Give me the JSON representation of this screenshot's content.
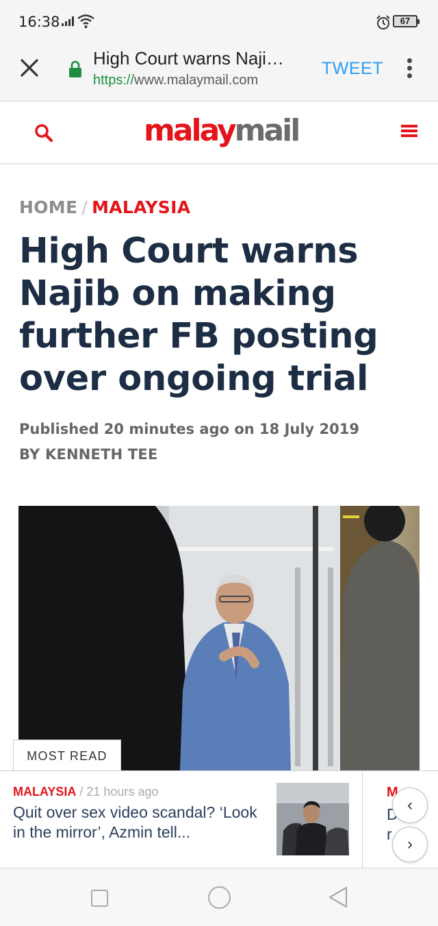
{
  "status_bar": {
    "time": "16:38",
    "battery": "67",
    "icons": [
      "signal-icon",
      "wifi-icon",
      "alarm-icon",
      "battery-icon"
    ]
  },
  "browser": {
    "page_title": "High Court warns Naji…",
    "url_scheme": "https://",
    "url_host": "www.malaymail.com",
    "tweet_label": "TWEET",
    "icons": [
      "close-icon",
      "lock-icon",
      "more-vert-icon"
    ]
  },
  "site_header": {
    "logo_part1": "malay",
    "logo_part2": "mail",
    "icons": [
      "search-icon",
      "menu-icon"
    ]
  },
  "article": {
    "breadcrumb": {
      "home": "HOME",
      "separator": "/",
      "section": "MALAYSIA"
    },
    "headline": "High Court warns Najib on making further FB posting over ongoing trial",
    "published": "Published 20 minutes ago on 18 July 2019",
    "byline": "BY KENNETH TEE"
  },
  "most_read": {
    "tab_label": "MOST READ",
    "item": {
      "section": "MALAYSIA",
      "separator": "/",
      "time": "21 hours ago",
      "title": "Quit over sex video scandal? ‘Look in the mirror’, Azmin tell..."
    },
    "next_peek": [
      "M",
      "D",
      "r"
    ],
    "prev_label": "‹",
    "next_label": "›"
  },
  "nav_bar": {
    "icons": [
      "recent-apps-icon",
      "home-icon",
      "back-icon"
    ]
  },
  "colors": {
    "brand_red": "#e3151a",
    "headline_navy": "#1d2d44",
    "tweet_blue": "#2a9df4",
    "https_green": "#1e8e3e"
  }
}
